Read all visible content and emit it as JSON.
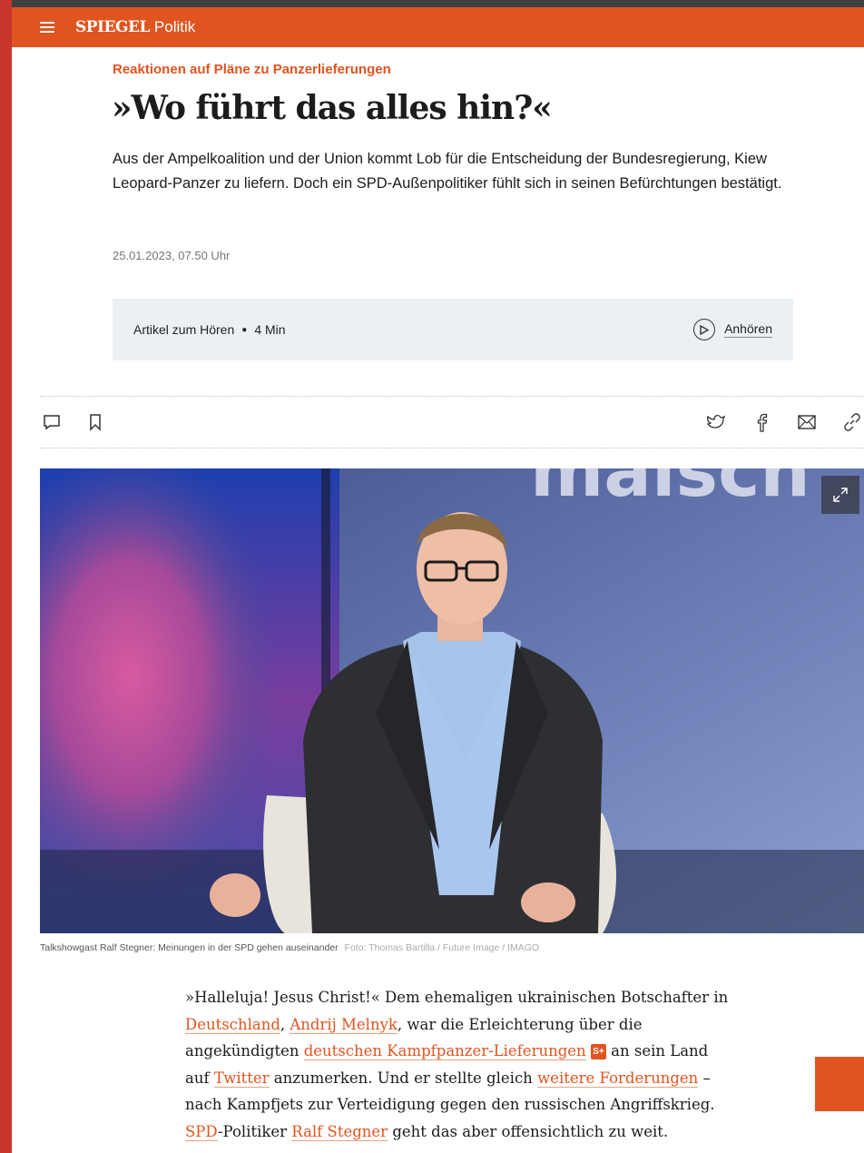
{
  "topbar": {
    "brand": "SPIEGEL",
    "section": "Politik",
    "color": "#e0541f"
  },
  "article": {
    "kicker": "Reaktionen auf Pläne zu Panzerlieferungen",
    "headline": "»Wo führt das alles hin?«",
    "teaser": "Aus der Ampelkoalition und der Union kommt Lob für die Entscheidung der Bundesregierung, Kiew Leopard-Panzer zu liefern. Doch ein SPD-Außenpolitiker fühlt sich in seinen Befürchtungen bestätigt.",
    "date": "25.01.2023, 07.50 Uhr"
  },
  "audio": {
    "label": "Artikel zum Hören",
    "duration": "4 Min",
    "listen_label": "Anhören"
  },
  "toolbar": {
    "icons": [
      "comment-icon",
      "bookmark-icon",
      "twitter-icon",
      "facebook-icon",
      "mail-icon",
      "link-icon"
    ]
  },
  "image": {
    "caption": "Talkshowgast Ralf Stegner: Meinungen in der SPD gehen auseinander",
    "credit": "Foto: Thomas Bartilla / Future Image / IMAGO",
    "backdrop_text": "maisch"
  },
  "body": {
    "t1": "»Halleluja! Jesus Christ!« Dem ehemaligen ukrainischen Botschafter in ",
    "l1": "Deutschland",
    "t2": ", ",
    "l2": "Andrij Melnyk",
    "t3": ", war die Erleichterung über die angekündigten ",
    "l3": "deutschen Kampfpanzer-Lieferungen",
    "badge": "S+",
    "t4": " an sein Land auf ",
    "l4": "Twitter",
    "t5": " anzumerken. Und er stellte gleich ",
    "l5": "weitere Forderungen",
    "t6": " – nach Kampfjets zur Verteidigung gegen den russischen Angriffskrieg. ",
    "l6": "SPD",
    "t7": "-Politiker ",
    "l7": "Ralf Stegner",
    "t8": " geht das aber offensichtlich zu weit."
  }
}
